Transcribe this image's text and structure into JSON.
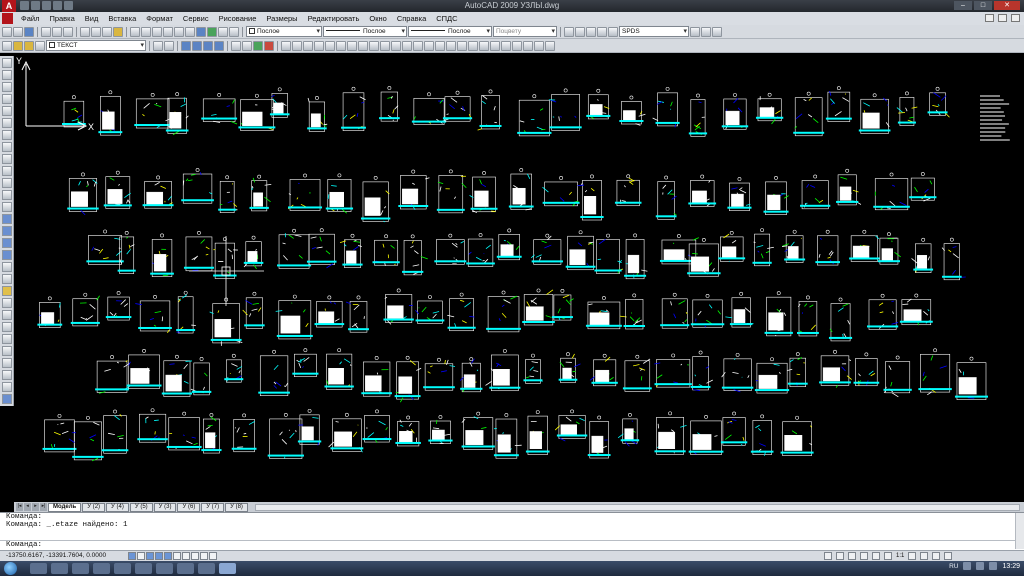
{
  "window": {
    "title": "AutoCAD 2009  УЗЛЫ.dwg",
    "controls": [
      "minimize",
      "maximize",
      "close"
    ]
  },
  "menu": {
    "items": [
      "Файл",
      "Правка",
      "Вид",
      "Вставка",
      "Формат",
      "Сервис",
      "Рисование",
      "Размеры",
      "Редактировать",
      "Окно",
      "Справка",
      "СПДС"
    ]
  },
  "toolbars": {
    "layer_combo": "Послое",
    "linetype_combo": "Послое",
    "lineweight_combo": "Послое",
    "plotstyle_combo": "Поцвету",
    "dimstyle_combo": "SPDS",
    "text_style_combo": "ТЕКСТ"
  },
  "layout_tabs": {
    "tabs": [
      "Модель",
      "У (2)",
      "У (4)",
      "У (5)",
      "У (3)",
      "У (6)",
      "У (7)",
      "У (8)"
    ],
    "active": "Модель"
  },
  "command": {
    "history": [
      "Команда:",
      "Команда: _.etaze найдено: 1"
    ],
    "prompt": "Команда:"
  },
  "status": {
    "coordinates": "-13750.6167, -13391.7604, 0.0000",
    "scale": "1:1",
    "language": "RU",
    "clock": "13:29"
  },
  "icons": {
    "app_logo": "autocad-logo-icon",
    "ucs": "ucs-axis-icon",
    "start": "windows-start-icon"
  },
  "colors": {
    "canvas": "#000000",
    "title_bar": "#2d3238",
    "ui_chrome": "#d6dae0",
    "taskbar": "#2b3a52",
    "cad_white": "#ffffff",
    "cad_cyan": "#00ffff",
    "cad_blue": "#0000ff",
    "cad_yellow": "#ffff00",
    "cad_green": "#00ff00"
  }
}
